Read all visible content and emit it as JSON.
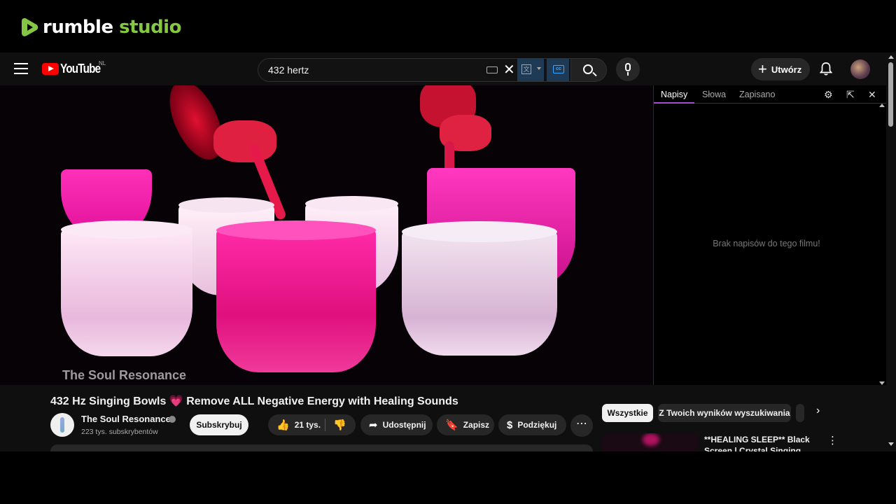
{
  "rumble": {
    "brand_word1": "rumble",
    "brand_word2": "studio"
  },
  "masthead": {
    "logo_text": "YouTube",
    "country_code": "NL",
    "search_value": "432 hertz",
    "create_label": "Utwórz"
  },
  "subtitles_panel": {
    "tabs": [
      "Napisy",
      "Słowa",
      "Zapisano"
    ],
    "active_tab": "Napisy",
    "empty_message": "Brak napisów do tego filmu!",
    "accent_color": "#a64dd6"
  },
  "video": {
    "watermark": "The Soul Resonance",
    "title": "432 Hz Singing Bowls",
    "title_emoji": "💗",
    "title_rest": "Remove ALL Negative Energy with Healing Sounds"
  },
  "channel": {
    "name": "The Soul Resonance",
    "subscribers": "223 tys. subskrybentów",
    "subscribe_label": "Subskrybuj"
  },
  "actions": {
    "likes": "21 tys.",
    "share": "Udostępnij",
    "save": "Zapisz",
    "thanks": "Podziękuj",
    "more": "⋯"
  },
  "chips": {
    "all": "Wszystkie",
    "from_search": "Z Twoich wyników wyszukiwania"
  },
  "recommendation": {
    "title": "**HEALING SLEEP** Black Screen | Crystal Singing Bowls"
  },
  "icons": {
    "menu": "hamburger-icon",
    "search": "search-icon",
    "mic": "mic-icon",
    "bell": "bell-icon",
    "like": "thumbs-up-icon",
    "dislike": "thumbs-down-icon",
    "share": "share-icon",
    "save": "bookmark-icon",
    "thanks": "thanks-icon"
  }
}
